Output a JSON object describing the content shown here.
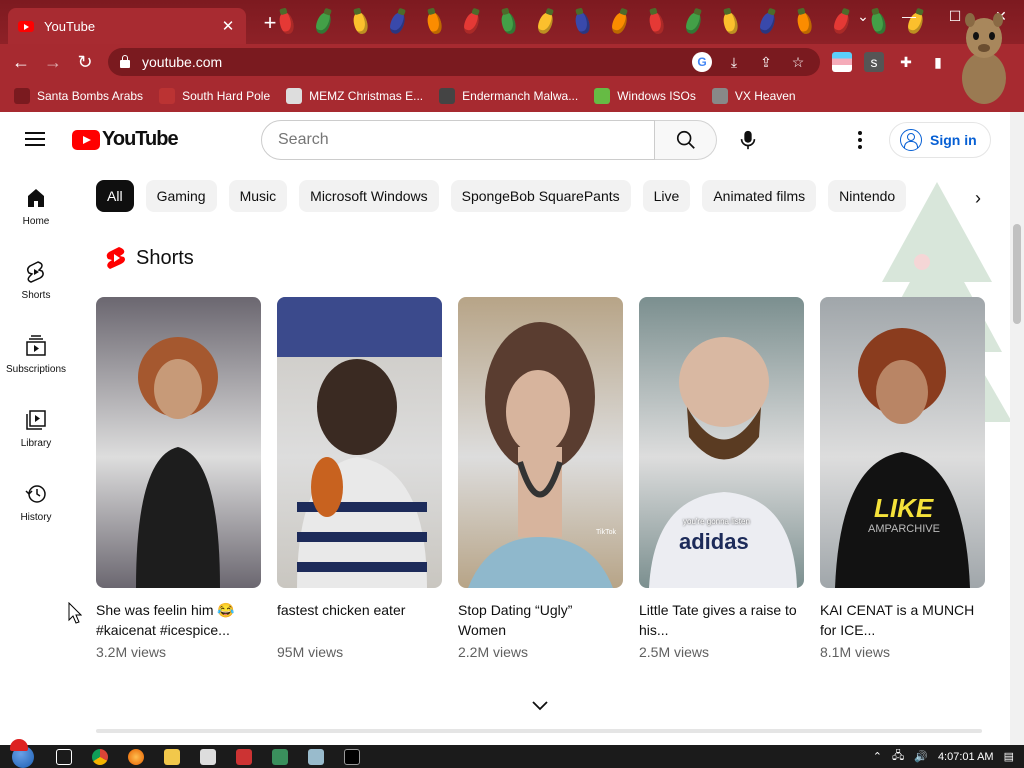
{
  "browser": {
    "tab_title": "YouTube",
    "tab_close": "✕",
    "new_tab": "+",
    "url": "youtube.com",
    "window_controls": {
      "chevron": "⌄",
      "minimize": "—",
      "maximize": "☐",
      "close": "✕"
    },
    "nav": {
      "back": "←",
      "forward": "→",
      "reload": "↻"
    },
    "omnibox_icons": [
      "google-icon",
      "install-icon",
      "share-icon",
      "star-icon"
    ],
    "bookmarks": [
      {
        "label": "Santa Bombs Arabs",
        "icon": "santa-icon",
        "color": "#7a1a1f"
      },
      {
        "label": "South Hard Pole",
        "icon": "bookmark-icon",
        "color": "#b33"
      },
      {
        "label": "MEMZ Christmas E...",
        "icon": "document-icon",
        "color": "#ddd"
      },
      {
        "label": "Endermanch Malwa...",
        "icon": "ghost-icon",
        "color": "#444"
      },
      {
        "label": "Windows ISOs",
        "icon": "tree-icon",
        "color": "#6b4"
      },
      {
        "label": "VX Heaven",
        "icon": "shield-icon",
        "color": "#888"
      }
    ]
  },
  "youtube": {
    "logo_text": "YouTube",
    "search_placeholder": "Search",
    "signin_label": "Sign in",
    "guide": [
      {
        "label": "Home",
        "icon": "home-icon"
      },
      {
        "label": "Shorts",
        "icon": "shorts-icon"
      },
      {
        "label": "Subscriptions",
        "icon": "subscriptions-icon"
      },
      {
        "label": "Library",
        "icon": "library-icon"
      },
      {
        "label": "History",
        "icon": "history-icon"
      }
    ],
    "chips": [
      "All",
      "Gaming",
      "Music",
      "Microsoft Windows",
      "SpongeBob SquarePants",
      "Live",
      "Animated films",
      "Nintendo"
    ],
    "shelf_title": "Shorts",
    "shorts": [
      {
        "title": "She was feelin him 😂 #kaicenat #icespice...",
        "views": "3.2M views",
        "bg": "#6b6770",
        "accent": "#a5582f"
      },
      {
        "title": "fastest chicken eater",
        "views": "95M views",
        "bg": "#c9c6c0",
        "accent": "#3a2a22"
      },
      {
        "title": "Stop Dating “Ugly” Women",
        "views": "2.2M views",
        "bg": "#b7a487",
        "accent": "#5a3d30"
      },
      {
        "title": "Little Tate gives a raise to his...",
        "views": "2.5M views",
        "bg": "#7b8f8f",
        "accent": "#d9b8a2"
      },
      {
        "title": "KAI CENAT is a MUNCH for ICE...",
        "views": "8.1M views",
        "bg": "#a0a6aa",
        "accent": "#8a3c1e"
      }
    ],
    "thumb_overlays": {
      "tiktok_mark": "TikTok",
      "caption_4": "you're gonna listen",
      "shirt_4": "adidas",
      "like_text": "LIKE",
      "like_sub": "AMPARCHIVE"
    }
  },
  "taskbar": {
    "clock": "4:07:01 AM",
    "apps": [
      "start-orb",
      "task-view-icon",
      "chrome-icon",
      "firefox-icon",
      "folder-icon",
      "7zip-icon",
      "devcpp-icon",
      "notepad-icon",
      "paint-icon",
      "cmd-icon"
    ]
  },
  "colors": {
    "chrome_red": "#a72a30",
    "youtube_red": "#ff0000",
    "signin_blue": "#065fd4",
    "chip_active": "#0f0f0f",
    "chip_bg": "#f2f2f2"
  }
}
